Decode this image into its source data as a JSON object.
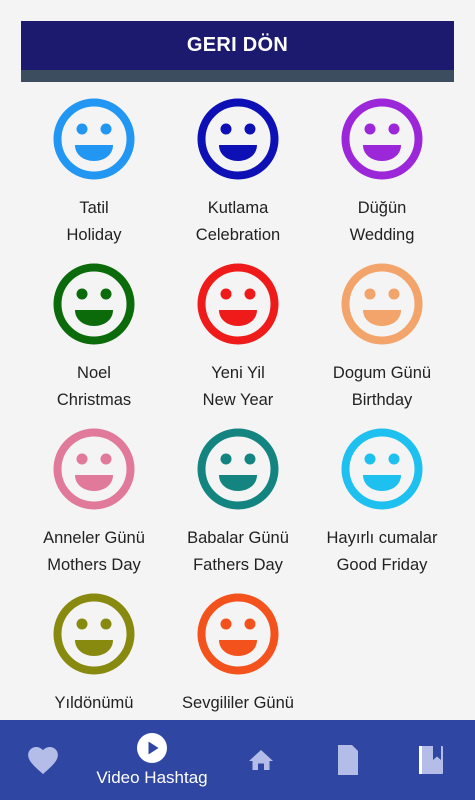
{
  "header": {
    "back_label": "GERI DÖN"
  },
  "items": [
    {
      "icon": "smiley-icon",
      "color": "#2196f3",
      "line1": "Tatil",
      "line2": "Holiday"
    },
    {
      "icon": "smiley-icon",
      "color": "#0d10b5",
      "line1": "Kutlama",
      "line2": "Celebration"
    },
    {
      "icon": "smiley-icon",
      "color": "#9c27d8",
      "line1": "Düğün",
      "line2": "Wedding"
    },
    {
      "icon": "smiley-icon",
      "color": "#0b6b0b",
      "line1": "Noel",
      "line2": "Christmas"
    },
    {
      "icon": "smiley-icon",
      "color": "#ef1b1b",
      "line1": "Yeni Yil",
      "line2": "New Year"
    },
    {
      "icon": "smiley-icon",
      "color": "#f2a46a",
      "line1": "Dogum Günü",
      "line2": "Birthday"
    },
    {
      "icon": "smiley-icon",
      "color": "#e0799a",
      "line1": "Anneler Günü",
      "line2": "Mothers Day"
    },
    {
      "icon": "smiley-icon",
      "color": "#138480",
      "line1": "Babalar Günü",
      "line2": "Fathers Day"
    },
    {
      "icon": "smiley-icon",
      "color": "#1ec0ef",
      "line1": "Hayırlı cumalar",
      "line2": "Good Friday"
    },
    {
      "icon": "smiley-icon",
      "color": "#888a10",
      "line1": "Yıldönümü",
      "line2": ""
    },
    {
      "icon": "smiley-icon",
      "color": "#f4521c",
      "line1": "Sevgililer Günü",
      "line2": ""
    }
  ],
  "bottom_nav": {
    "favorites_icon": "heart-icon",
    "video_icon": "play-circle-icon",
    "video_label": "Video Hashtag",
    "home_icon": "home-icon",
    "page_icon": "page-icon",
    "bookmark_icon": "bookmark-icon"
  }
}
